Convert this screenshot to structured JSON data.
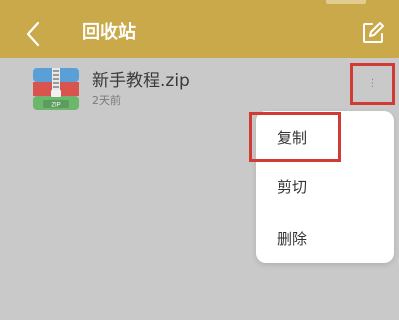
{
  "header": {
    "title": "回收站",
    "back_icon": "chevron-left-icon",
    "edit_icon": "edit-icon",
    "background": "#c9a94a"
  },
  "file": {
    "name": "新手教程.zip",
    "date": "2天前",
    "icon": "zip-file-icon",
    "icon_label": "ZIP"
  },
  "more_button": {
    "icon": "more-vertical-icon",
    "highlight_color": "#d23a36"
  },
  "context_menu": {
    "items": [
      {
        "label": "复制"
      },
      {
        "label": "剪切"
      },
      {
        "label": "删除"
      }
    ]
  }
}
